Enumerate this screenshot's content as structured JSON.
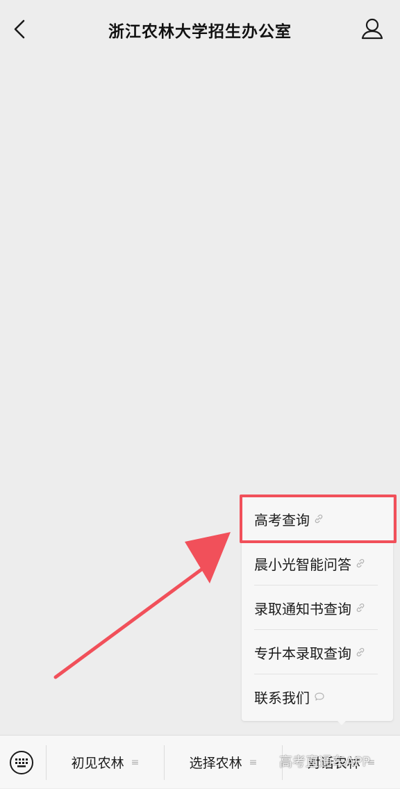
{
  "header": {
    "title": "浙江农林大学招生办公室",
    "back_icon": "chevron-left-icon",
    "profile_icon": "person-icon"
  },
  "submenu": {
    "items": [
      {
        "label": "高考查询",
        "icon": "link-icon"
      },
      {
        "label": "晨小光智能问答",
        "icon": "link-icon"
      },
      {
        "label": "录取通知书查询",
        "icon": "link-icon"
      },
      {
        "label": "专升本录取查询",
        "icon": "link-icon"
      },
      {
        "label": "联系我们",
        "icon": "chat-bubble-icon"
      }
    ],
    "highlight_color": "#f1505a"
  },
  "bottom_bar": {
    "keyboard_icon": "keyboard-icon",
    "items": [
      {
        "label": "初见农林",
        "icon": "menu-lines-icon"
      },
      {
        "label": "选择农林",
        "icon": "menu-lines-icon"
      },
      {
        "label": "对话农林",
        "icon": "menu-lines-icon"
      }
    ]
  },
  "watermark": "高考直通车APP"
}
